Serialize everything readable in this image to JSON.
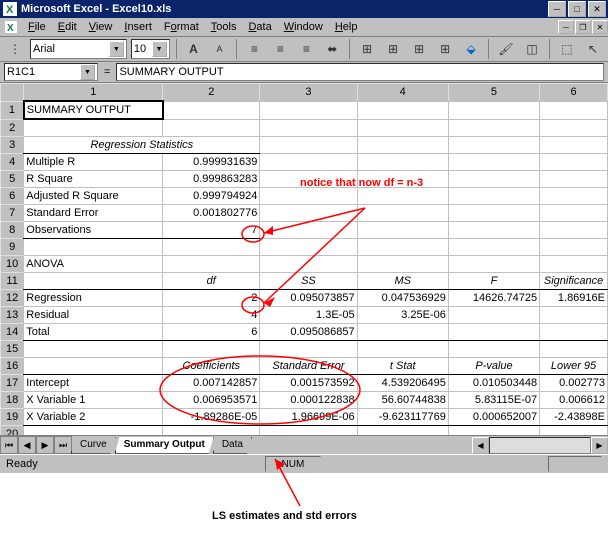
{
  "titlebar": {
    "app": "Microsoft Excel",
    "doc": "Excel10.xls"
  },
  "menu": [
    "File",
    "Edit",
    "View",
    "Insert",
    "Format",
    "Tools",
    "Data",
    "Window",
    "Help"
  ],
  "font": {
    "name": "Arial",
    "size": "10"
  },
  "namebox": "R1C1",
  "formula": "SUMMARY OUTPUT",
  "cols": [
    "1",
    "2",
    "3",
    "4",
    "5",
    "6"
  ],
  "rows": {
    "1": [
      "SUMMARY OUTPUT",
      "",
      "",
      "",
      "",
      ""
    ],
    "3": [
      "Regression Statistics"
    ],
    "4": [
      "Multiple R",
      "0.999931639"
    ],
    "5": [
      "R Square",
      "0.999863283"
    ],
    "6": [
      "Adjusted R Square",
      "0.999794924"
    ],
    "7": [
      "Standard Error",
      "0.001802776"
    ],
    "8": [
      "Observations",
      "7"
    ],
    "10": [
      "ANOVA"
    ],
    "11": [
      "",
      "df",
      "SS",
      "MS",
      "F",
      "Significance"
    ],
    "12": [
      "Regression",
      "2",
      "0.095073857",
      "0.047536929",
      "14626.74725",
      "1.86916E"
    ],
    "13": [
      "Residual",
      "4",
      "1.3E-05",
      "3.25E-06",
      "",
      ""
    ],
    "14": [
      "Total",
      "6",
      "0.095086857",
      "",
      "",
      ""
    ],
    "16": [
      "",
      "Coefficients",
      "Standard Error",
      "t Stat",
      "P-value",
      "Lower 95"
    ],
    "17": [
      "Intercept",
      "0.007142857",
      "0.001573592",
      "4.539206495",
      "0.010503448",
      "0.002773"
    ],
    "18": [
      "X Variable 1",
      "0.006953571",
      "0.000122838",
      "56.60744838",
      "5.83115E-07",
      "0.006612"
    ],
    "19": [
      "X Variable 2",
      "-1.89286E-05",
      "1.96699E-06",
      "-9.623117769",
      "0.000652007",
      "-2.43898E"
    ]
  },
  "tabs": [
    "Curve",
    "Summary Output",
    "Data"
  ],
  "status": {
    "ready": "Ready",
    "num": "NUM"
  },
  "annots": {
    "df": "notice that now df = n-3",
    "ls": "LS estimates and std errors"
  },
  "chart_data": {
    "type": "table",
    "title": "Regression SUMMARY OUTPUT",
    "regression_stats": {
      "Multiple R": 0.999931639,
      "R Square": 0.999863283,
      "Adjusted R Square": 0.999794924,
      "Standard Error": 0.001802776,
      "Observations": 7
    },
    "anova": [
      {
        "source": "Regression",
        "df": 2,
        "SS": 0.095073857,
        "MS": 0.047536929,
        "F": 14626.74725
      },
      {
        "source": "Residual",
        "df": 4,
        "SS": 1.3e-05,
        "MS": 3.25e-06
      },
      {
        "source": "Total",
        "df": 6,
        "SS": 0.095086857
      }
    ],
    "coefficients": [
      {
        "name": "Intercept",
        "coef": 0.007142857,
        "se": 0.001573592,
        "t": 4.539206495,
        "p": 0.010503448
      },
      {
        "name": "X Variable 1",
        "coef": 0.006953571,
        "se": 0.000122838,
        "t": 56.60744838,
        "p": 5.83115e-07
      },
      {
        "name": "X Variable 2",
        "coef": -1.89286e-05,
        "se": 1.96699e-06,
        "t": -9.623117769,
        "p": 0.000652007
      }
    ]
  }
}
